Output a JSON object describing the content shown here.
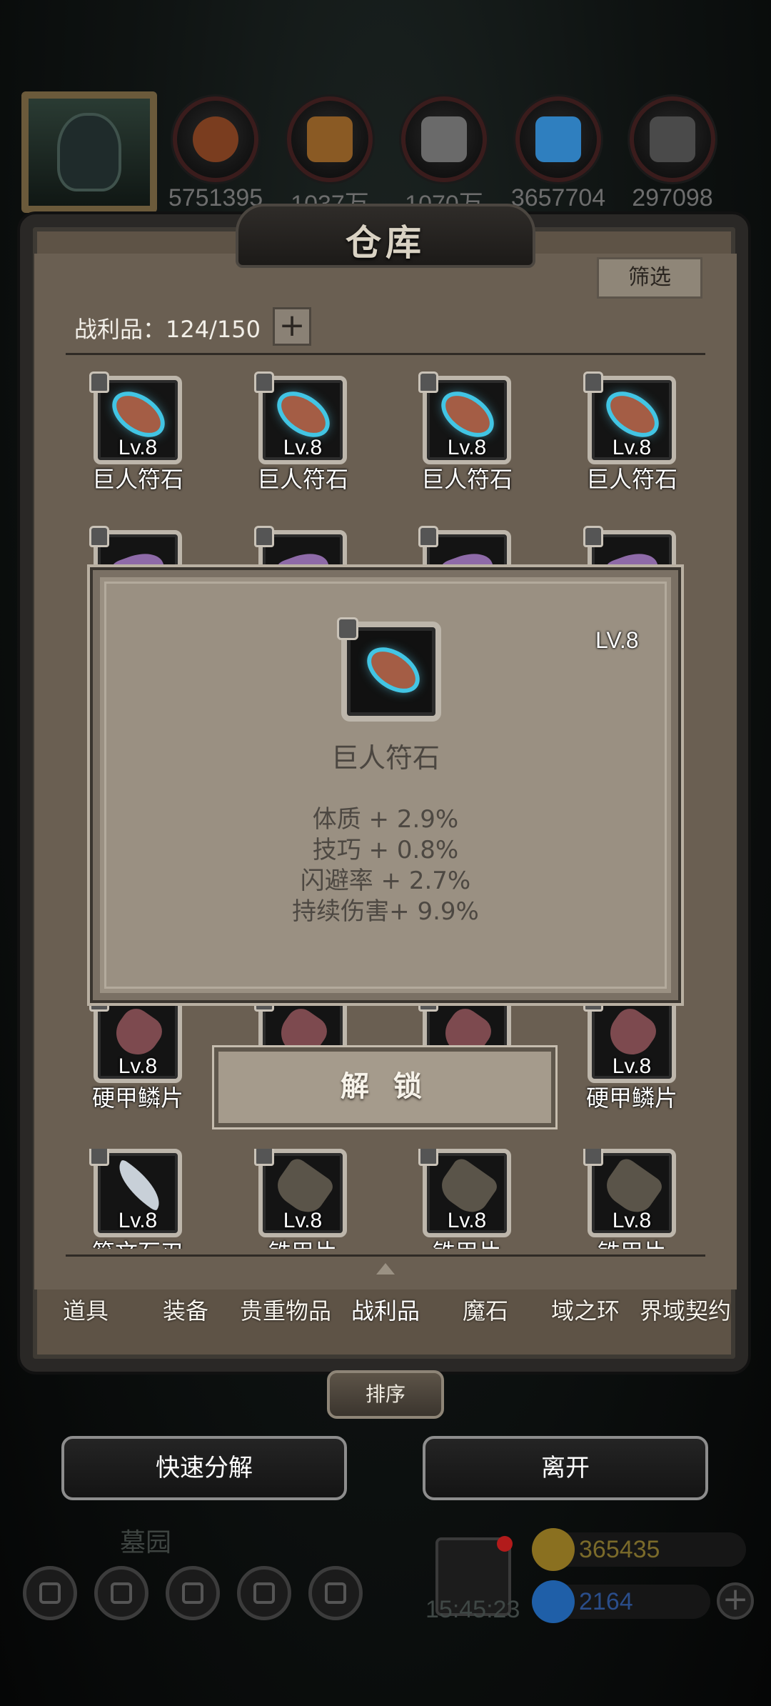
{
  "top_resources": [
    {
      "icon": "meat-icon",
      "value": "5751395",
      "color": "#7a3d1f"
    },
    {
      "icon": "wood-icon",
      "value": "1037万",
      "color": "#8a5a24"
    },
    {
      "icon": "iron-icon",
      "value": "1070万",
      "color": "#6a6a6a"
    },
    {
      "icon": "crystal-icon",
      "value": "3657704",
      "color": "#2f7fbf"
    },
    {
      "icon": "steel-icon",
      "value": "297098",
      "color": "#4a4a4a"
    }
  ],
  "panel": {
    "title": "仓库",
    "filter_label": "筛选",
    "loot_count": "战利品：124/150",
    "plus_label": "+"
  },
  "items": [
    {
      "level": "Lv.8",
      "name": "巨人符石",
      "art": "rune"
    },
    {
      "level": "Lv.8",
      "name": "巨人符石",
      "art": "rune"
    },
    {
      "level": "Lv.8",
      "name": "巨人符石",
      "art": "rune"
    },
    {
      "level": "Lv.8",
      "name": "巨人符石",
      "art": "rune"
    },
    {
      "level": "",
      "name": "",
      "art": "crystal"
    },
    {
      "level": "",
      "name": "",
      "art": "crystal"
    },
    {
      "level": "",
      "name": "",
      "art": "crystal"
    },
    {
      "level": "",
      "name": "",
      "art": "crystal"
    },
    {
      "level": "Lv.8",
      "name": "硬甲鳞片",
      "art": "scale"
    },
    {
      "level": "",
      "name": "",
      "art": "scale"
    },
    {
      "level": "",
      "name": "",
      "art": "scale"
    },
    {
      "level": "Lv.8",
      "name": "硬甲鳞片",
      "art": "scale"
    },
    {
      "level": "Lv.8",
      "name": "符文石刃",
      "art": "blade"
    },
    {
      "level": "Lv.8",
      "name": "铁甲片",
      "art": "boots"
    },
    {
      "level": "Lv.8",
      "name": "铁甲片",
      "art": "boots"
    },
    {
      "level": "Lv.8",
      "name": "铁甲片",
      "art": "boots"
    }
  ],
  "popup": {
    "level": "LV.8",
    "name": "巨人符石",
    "stats": [
      "体质 + 2.9%",
      "技巧 + 0.8%",
      "闪避率 + 2.7%",
      "持续伤害+ 9.9%"
    ],
    "unlock_label": "解 锁"
  },
  "tabs": [
    "道具",
    "装备",
    "贵重物品",
    "战利品",
    "魔石",
    "域之环",
    "界域契约"
  ],
  "active_tab": "战利品",
  "sort_label": "排序",
  "quick_decompose_label": "快速分解",
  "leave_label": "离开",
  "bottom": {
    "scene": "墓园",
    "clock": "15:45:23",
    "gold": "365435",
    "gems": "2164",
    "gold_color": "#7a6a2a",
    "gem_color": "#2a4d8a"
  }
}
